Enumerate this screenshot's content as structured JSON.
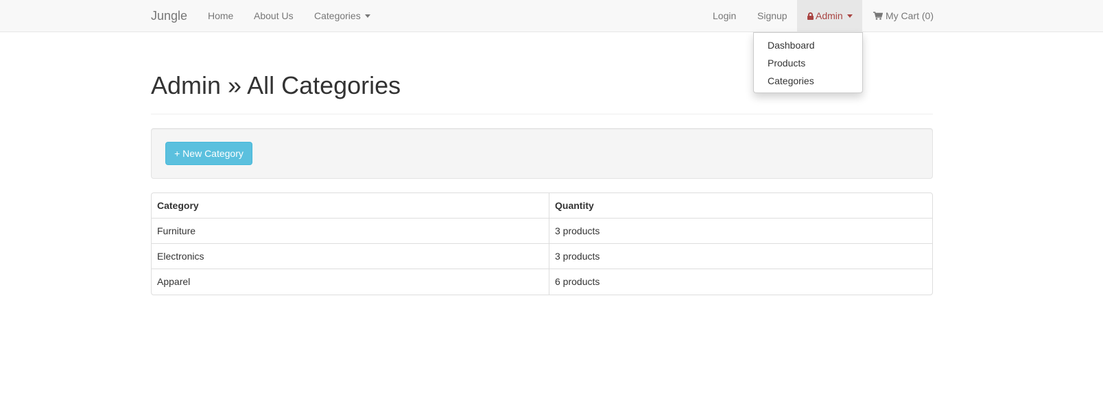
{
  "navbar": {
    "brand": "Jungle",
    "left_links": [
      "Home",
      "About Us",
      "Categories"
    ],
    "right_links": {
      "login": "Login",
      "signup": "Signup",
      "admin": "Admin",
      "cart": "My Cart (0)"
    },
    "icons": {
      "admin": "lock-icon",
      "cart": "cart-icon"
    }
  },
  "admin_menu": {
    "items": [
      "Dashboard",
      "Products",
      "Categories"
    ]
  },
  "page": {
    "title": "Admin » All Categories"
  },
  "toolbar": {
    "new_category": "+ New Category"
  },
  "table": {
    "headers": [
      "Category",
      "Quantity"
    ],
    "rows": [
      [
        "Furniture",
        "3 products"
      ],
      [
        "Electronics",
        "3 products"
      ],
      [
        "Apparel",
        "6 products"
      ]
    ]
  },
  "colors": {
    "accent": "#5bc0de",
    "admin_text": "#a94442",
    "navbar_bg": "#f8f8f8"
  }
}
